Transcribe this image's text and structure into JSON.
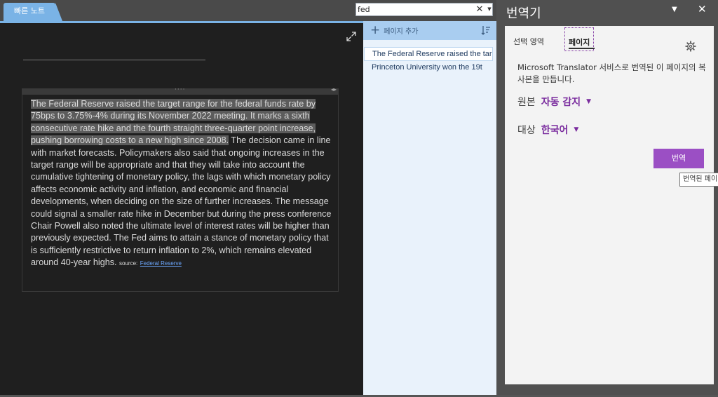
{
  "section_tab": "빠른 노트",
  "search": {
    "value": "fed"
  },
  "page_list": {
    "add_page_label": "페이지 추가",
    "items": [
      "The Federal Reserve raised the tar",
      "Princeton University won the 19t"
    ]
  },
  "note": {
    "paragraph_highlighted": "The Federal Reserve raised the target range for the federal funds rate by 75bps to 3.75%-4% during its November 2022 meeting. It marks a sixth consecutive rate hike and the fourth straight three-quarter point increase, pushing borrowing costs to a new high since 2008.",
    "paragraph_rest": " The decision came in line with market forecasts. Policymakers also said that ongoing increases in the target range will be appropriate and that they will take into account the cumulative tightening of monetary policy, the lags with which monetary policy affects economic activity and inflation, and economic and financial developments, when deciding on the size of further increases. The message could signal a smaller rate hike in December but during the press conference Chair Powell also noted the ultimate level of interest rates will be higher than previously expected. The Fed aims to attain a stance of monetary policy that is sufficiently restrictive to return inflation to 2%, which remains elevated around 40-year highs.",
    "source_label": "source:",
    "source_link": "Federal Reserve"
  },
  "translator": {
    "title": "번역기",
    "tabs": {
      "selection": "선택 영역",
      "page": "페이지"
    },
    "description": "Microsoft Translator 서비스로 번역된 이 페이지의 복사본을 만듭니다.",
    "source_label": "원본",
    "source_value": "자동 감지",
    "target_label": "대상",
    "target_value": "한국어",
    "translate_button": "번역",
    "tooltip": "번역된 페이"
  },
  "colors": {
    "accent": "#7ab3e6",
    "purple": "#7a2c9e",
    "button": "#9b4fc4"
  },
  "icons": [
    "expand-icon",
    "plus-icon",
    "sort-icon",
    "clear-icon",
    "dropdown-icon",
    "gear-icon",
    "close-icon",
    "chevron-down-icon"
  ]
}
